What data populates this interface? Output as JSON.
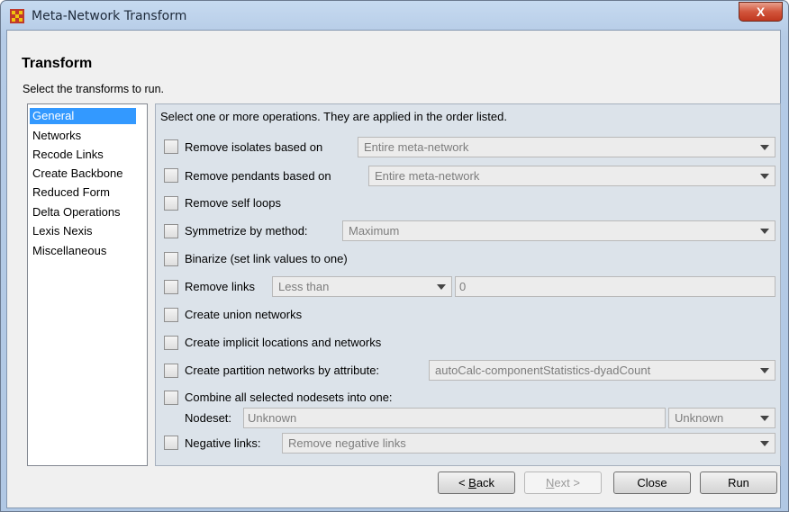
{
  "window": {
    "title": "Meta-Network Transform",
    "close_glyph": "X",
    "icon": "app-grid-icon"
  },
  "header": {
    "heading": "Transform",
    "subheading": "Select the transforms to run."
  },
  "sidebar": {
    "items": [
      {
        "label": "General",
        "selected": true
      },
      {
        "label": "Networks",
        "selected": false
      },
      {
        "label": "Recode Links",
        "selected": false
      },
      {
        "label": "Create Backbone",
        "selected": false
      },
      {
        "label": "Reduced Form",
        "selected": false
      },
      {
        "label": "Delta Operations",
        "selected": false
      },
      {
        "label": "Lexis Nexis",
        "selected": false
      },
      {
        "label": "Miscellaneous",
        "selected": false
      }
    ]
  },
  "main": {
    "intro": "Select one or more operations. They are applied in the order listed.",
    "ops": {
      "isolates": {
        "label": "Remove isolates based on",
        "value": "Entire meta-network",
        "checked": false
      },
      "pendants": {
        "label": "Remove pendants based on",
        "value": "Entire meta-network",
        "checked": false
      },
      "self_loops": {
        "label": "Remove self loops",
        "checked": false
      },
      "symmetrize": {
        "label": "Symmetrize by method:",
        "value": "Maximum",
        "checked": false
      },
      "binarize": {
        "label": "Binarize (set link values to one)",
        "checked": false
      },
      "remove_links": {
        "label": "Remove links",
        "value": "Less than",
        "threshold": "0",
        "checked": false
      },
      "union": {
        "label": "Create union networks",
        "checked": false
      },
      "implicit": {
        "label": "Create implicit locations and networks",
        "checked": false
      },
      "partition": {
        "label": "Create partition networks by attribute:",
        "value": "autoCalc-componentStatistics-dyadCount",
        "checked": false
      },
      "combine": {
        "label": "Combine all selected nodesets into one:",
        "checked": false,
        "nodeset_label": "Nodeset:",
        "nodeset_value": "Unknown",
        "type_value": "Unknown"
      },
      "negative": {
        "label": "Negative links:",
        "value": "Remove negative links",
        "checked": false
      }
    }
  },
  "footer": {
    "back": {
      "mnemonic": "B",
      "rest": "ack",
      "prefix": "< "
    },
    "next": {
      "mnemonic": "N",
      "rest": "ext >"
    },
    "close": "Close",
    "run": "Run"
  },
  "colors": {
    "selection": "#3399ff",
    "frame": "#b5cbe6",
    "close_button": "#d2553c"
  }
}
